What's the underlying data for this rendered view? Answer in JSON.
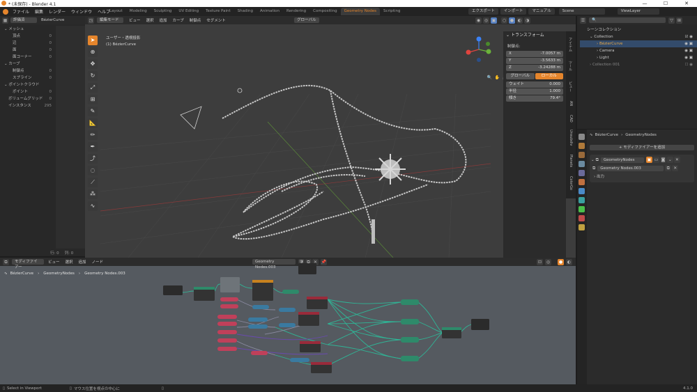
{
  "titlebar": {
    "title": "* (未保存) - Blender 4.1",
    "minimize": "—",
    "maximize": "☐",
    "close": "✕"
  },
  "menu": [
    "ファイル",
    "編集",
    "レンダー",
    "ウィンドウ",
    "ヘルプ"
  ],
  "workspaces": [
    "Layout",
    "Modeling",
    "Sculpting",
    "UV Editing",
    "Texture Paint",
    "Shading",
    "Animation",
    "Rendering",
    "Compositing",
    "Geometry Nodes",
    "Scripting"
  ],
  "active_workspace": "Geometry Nodes",
  "topbar_right": {
    "export": "エクスポート",
    "import": "インポート",
    "manual": "マニュアル",
    "scene": "Scene",
    "view_layer": "ViewLayer"
  },
  "spreadsheet": {
    "mode": "評価済",
    "object": "BézierCurve",
    "tree": [
      {
        "label": "メッシュ",
        "value": "",
        "level": 0
      },
      {
        "label": "頂点",
        "value": "0",
        "level": 1
      },
      {
        "label": "辺",
        "value": "0",
        "level": 1
      },
      {
        "label": "面",
        "value": "0",
        "level": 1
      },
      {
        "label": "面コーナー",
        "value": "0",
        "level": 1
      },
      {
        "label": "カーブ",
        "value": "",
        "level": 0
      },
      {
        "label": "制御点",
        "value": "0",
        "level": 1
      },
      {
        "label": "スプライン",
        "value": "0",
        "level": 1
      },
      {
        "label": "ポイントクラウド",
        "value": "",
        "level": 0
      },
      {
        "label": "ポイント",
        "value": "0",
        "level": 1
      },
      {
        "label": "ボリュームグリッド",
        "value": "0",
        "level": 0
      },
      {
        "label": "インスタンス",
        "value": "295",
        "level": 0
      }
    ],
    "footer_rows": "行: 0",
    "footer_cols": "列: 0"
  },
  "viewport": {
    "mode": "編集モード",
    "menus": [
      "ビュー",
      "選択",
      "追加",
      "カーブ",
      "制御点",
      "セグメント"
    ],
    "transform_orient": "グローバル",
    "info_line1": "ユーザー・透視投影",
    "info_line2": "(1) BézierCurve"
  },
  "npanel": {
    "title": "トランスフォーム",
    "section": "制御点:",
    "fields": [
      {
        "label": "X",
        "value": "-7.0057 m"
      },
      {
        "label": "Y",
        "value": "-3.5633 m"
      },
      {
        "label": "Z",
        "value": "-3.24288 m"
      }
    ],
    "toggle_global": "グローバル",
    "toggle_local": "ローカル",
    "props": [
      {
        "label": "ウェイト",
        "value": "0.000"
      },
      {
        "label": "半径",
        "value": "1.000"
      },
      {
        "label": "傾き",
        "value": "79.4°"
      }
    ],
    "tabs": [
      "アイテム",
      "ツール",
      "ビュー",
      "AN",
      "CAD",
      "Unsubdiv",
      "Planets",
      "ColorGo"
    ]
  },
  "outliner": {
    "title": "シーンコレクション",
    "items": [
      {
        "label": "Collection",
        "level": 0
      },
      {
        "label": "BézierCurve",
        "level": 1,
        "active": true
      },
      {
        "label": "Camera",
        "level": 1
      },
      {
        "label": "Light",
        "level": 1
      },
      {
        "label": "Collection 001",
        "level": 0
      }
    ]
  },
  "properties": {
    "breadcrumb_obj": "BézierCurve",
    "breadcrumb_mod": "GeometryNodes",
    "add_modifier": "モディファイアーを追加",
    "modifier_name": "GeometryNodes",
    "node_group": "Geometry Nodes.003",
    "sub": "出力"
  },
  "node_editor": {
    "menus": [
      "モディファイアー",
      "ビュー",
      "選択",
      "追加",
      "ノード"
    ],
    "group": "Geometry Nodes.003",
    "breadcrumb": [
      "BézierCurve",
      "GeometryNodes",
      "Geometry Nodes.003"
    ]
  },
  "statusbar": {
    "left": "Select in Viewport",
    "mid": "マウス位置を視点の中心に",
    "version": "4.1.0"
  }
}
